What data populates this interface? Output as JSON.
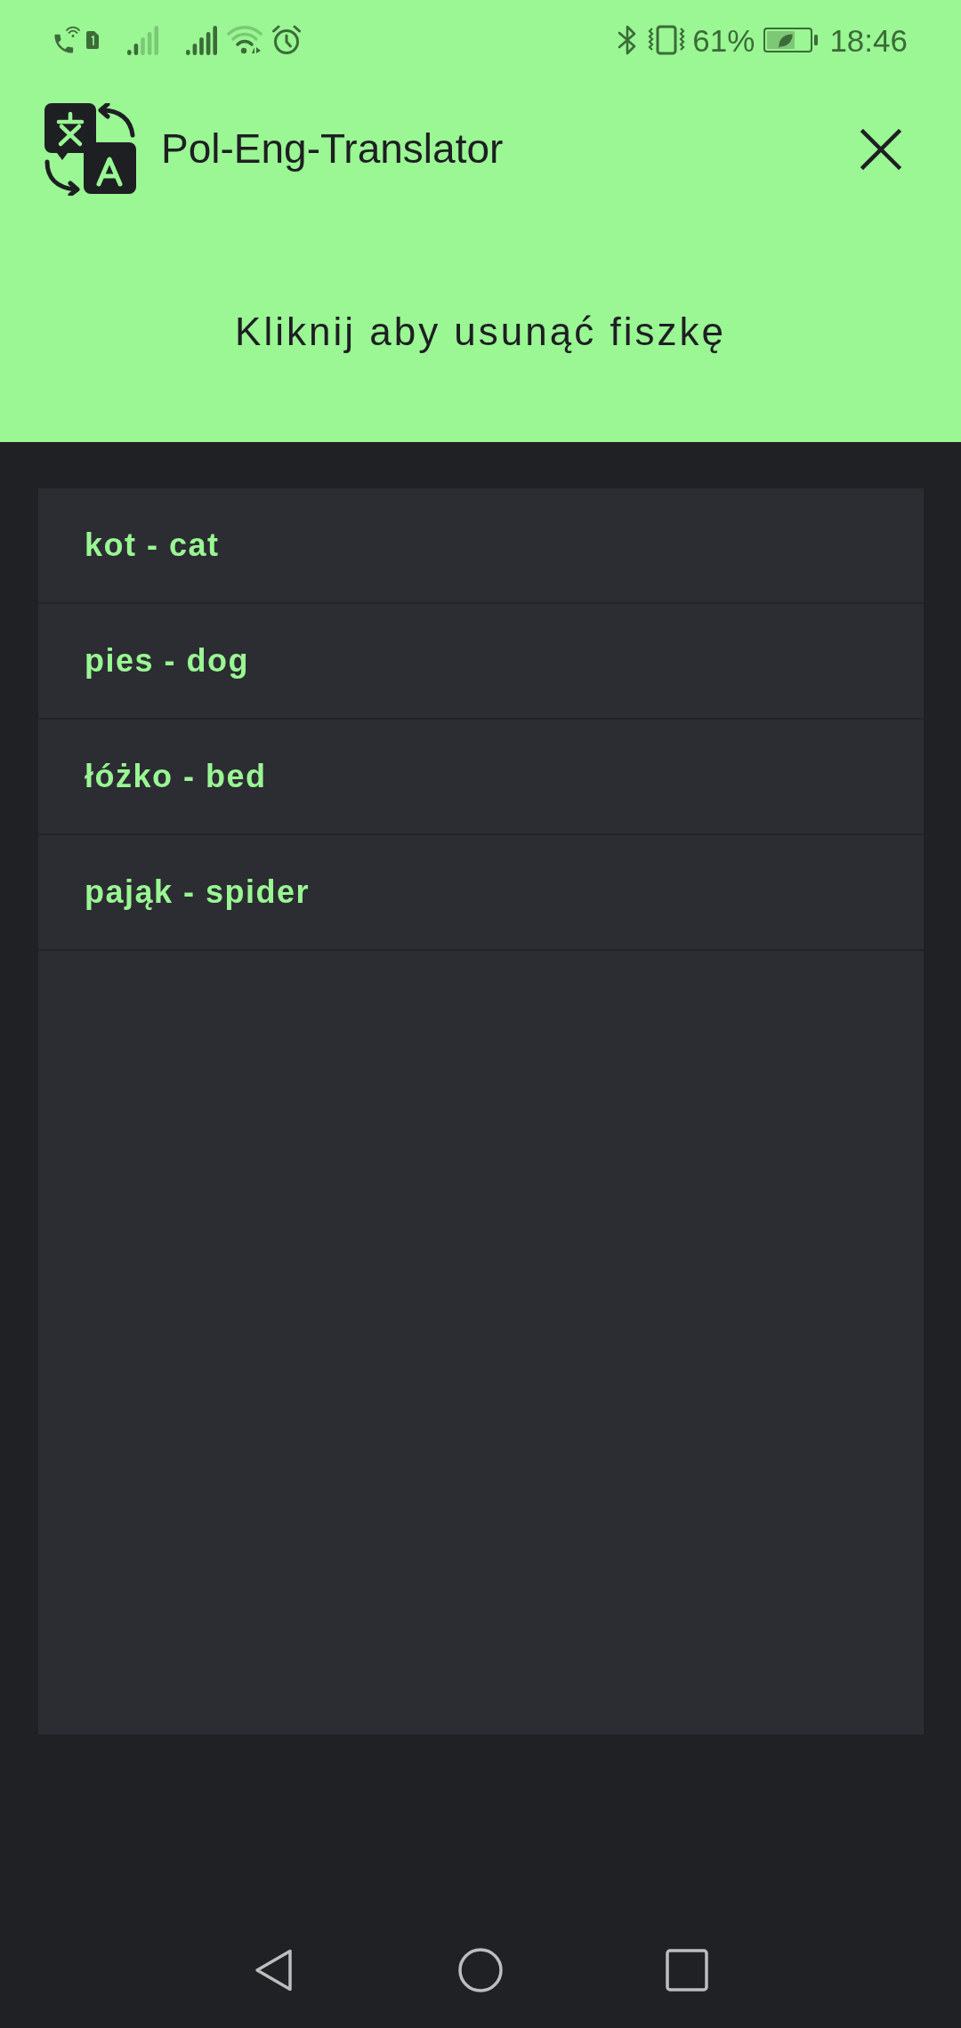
{
  "status_bar": {
    "battery": "61%",
    "time": "18:46"
  },
  "app_bar": {
    "title": "Pol-Eng-Translator"
  },
  "instruction": "Kliknij aby usunąć fiszkę",
  "flashcards": [
    "kot - cat",
    "pies - dog",
    "łóżko - bed",
    "pająk - spider"
  ]
}
